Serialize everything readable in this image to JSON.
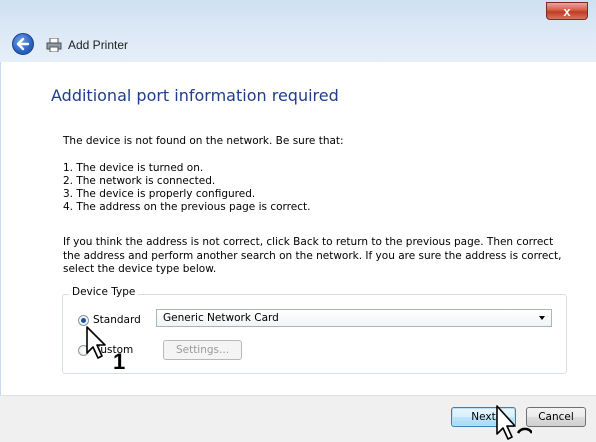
{
  "window": {
    "title": "Add Printer",
    "close_glyph": "x"
  },
  "page": {
    "heading": "Additional port information required",
    "intro": "The device is not found on the network.  Be sure that:",
    "checklist": [
      "1.  The device is turned on.",
      "2.  The network is connected.",
      "3.  The device is properly configured.",
      "4.  The address on the previous page is correct."
    ],
    "paragraph": "If you think the address is not correct, click Back to return to the previous page.  Then correct the address and perform another search on the network.  If you are sure the address is correct, select the device type below."
  },
  "device_type": {
    "legend": "Device Type",
    "standard_label": "Standard",
    "standard_checked": true,
    "custom_label": "Custom",
    "custom_checked": false,
    "selected_card": "Generic Network Card",
    "settings_label": "Settings..."
  },
  "buttons": {
    "next_label": "Next",
    "cancel_label": "Cancel"
  },
  "callouts": {
    "step1": "1"
  },
  "icons": {
    "back": "back-arrow-icon",
    "printer": "printer-icon",
    "cursor": "mouse-pointer-icon",
    "close": "close-icon"
  }
}
